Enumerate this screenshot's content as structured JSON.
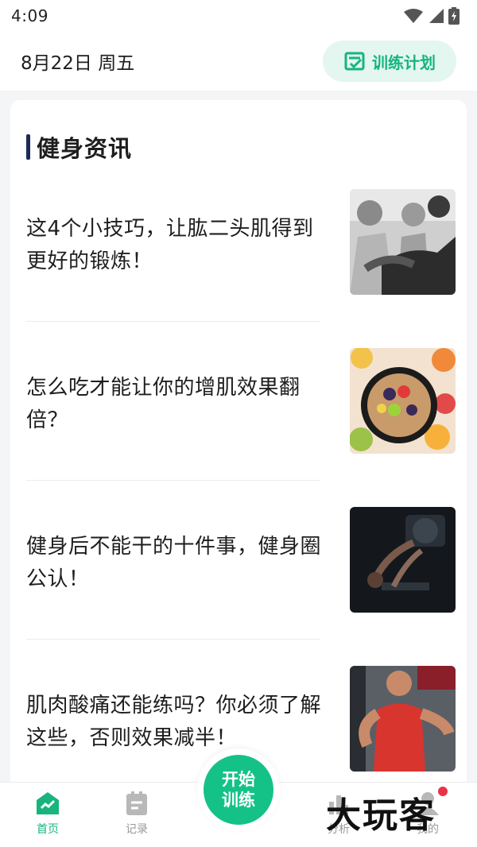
{
  "status_bar": {
    "time": "4:09"
  },
  "header": {
    "date": "8月22日 周五",
    "plan_button_label": "训练计划"
  },
  "section": {
    "title": "健身资讯"
  },
  "news": [
    {
      "title": "这4个小技巧，让肱二头肌得到更好的锻炼！",
      "image": "biceps-workout-photo"
    },
    {
      "title": "怎么吃才能让你的增肌效果翻倍？",
      "image": "fruit-bowl-photo"
    },
    {
      "title": "健身后不能干的十件事，健身圈公认！",
      "image": "leg-press-photo"
    },
    {
      "title": "肌肉酸痛还能练吗？你必须了解这些，否则效果减半！",
      "image": "cable-chest-photo"
    }
  ],
  "tab_bar": {
    "items": [
      {
        "label": "首页",
        "active": true,
        "icon": "home-icon"
      },
      {
        "label": "记录",
        "active": false,
        "icon": "record-icon"
      },
      {
        "label": "分析",
        "active": false,
        "icon": "analysis-icon"
      },
      {
        "label": "我的",
        "active": false,
        "icon": "profile-icon"
      }
    ],
    "start_line1": "开始",
    "start_line2": "训练"
  },
  "watermark": "大玩客",
  "colors": {
    "accent": "#14c287",
    "accent_light": "#e3f6ef",
    "title_bar": "#1d2a55"
  }
}
